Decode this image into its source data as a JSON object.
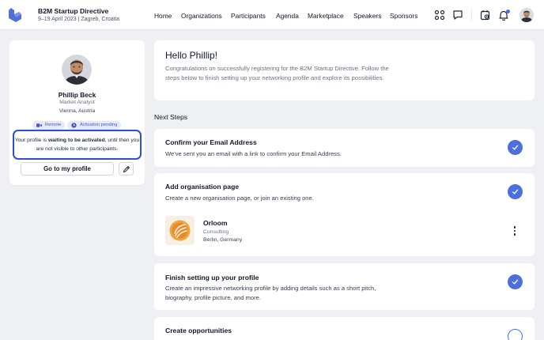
{
  "header": {
    "event_title": "B2M Startup Directive",
    "event_subtitle": "9–19 April 2023 | Zagreb, Croatia",
    "nav": [
      "Home",
      "Organizations",
      "Participants",
      "Agenda",
      "Marketplace",
      "Speakers",
      "Sponsors"
    ],
    "icons": [
      "apps-grid-icon",
      "chat-icon",
      "calendar-clock-icon",
      "bell-icon",
      "user-avatar"
    ],
    "brand_color": "#4f6fe0"
  },
  "profile": {
    "name": "Phillip Beck",
    "role": "Market Analyst",
    "location": "Vienna, Austria",
    "badges": {
      "remote": "Remote",
      "activation": "Activation pending"
    },
    "notice": {
      "prefix": "Your profile is ",
      "bold": "waiting to be activated",
      "suffix": ", until then you are not visible to other participants."
    },
    "goto_button": "Go to my profile"
  },
  "hello": {
    "title": "Hello Phillip!",
    "text": "Congratulations on successfully registering for the B2M Startup Directive. Follow the steps below to finish setting up your networking profile and explore its possibilities."
  },
  "next_steps_label": "Next Steps",
  "steps": [
    {
      "title": "Confirm your Email Address",
      "desc": "We've sent you an email with a link to confirm your Email Address.",
      "done": true
    },
    {
      "title": "Add organisation page",
      "desc": "Create a new organisation page, or join an existing one.",
      "done": true,
      "organisation": {
        "name": "Orloom",
        "category": "Consulting",
        "location": "Berlin, Germany"
      }
    },
    {
      "title": "Finish setting up your profile",
      "desc": "Create an impressive networking profile by adding details such as a short pitch, biography, profile picture, and more.",
      "done": true
    },
    {
      "title": "Create opportunities",
      "desc": "",
      "done": false
    }
  ],
  "colors": {
    "accent": "#4c6fe0",
    "notice_border": "#2d4ed8",
    "badge_bg": "#e6eaf8",
    "badge_text": "#4659c4"
  }
}
